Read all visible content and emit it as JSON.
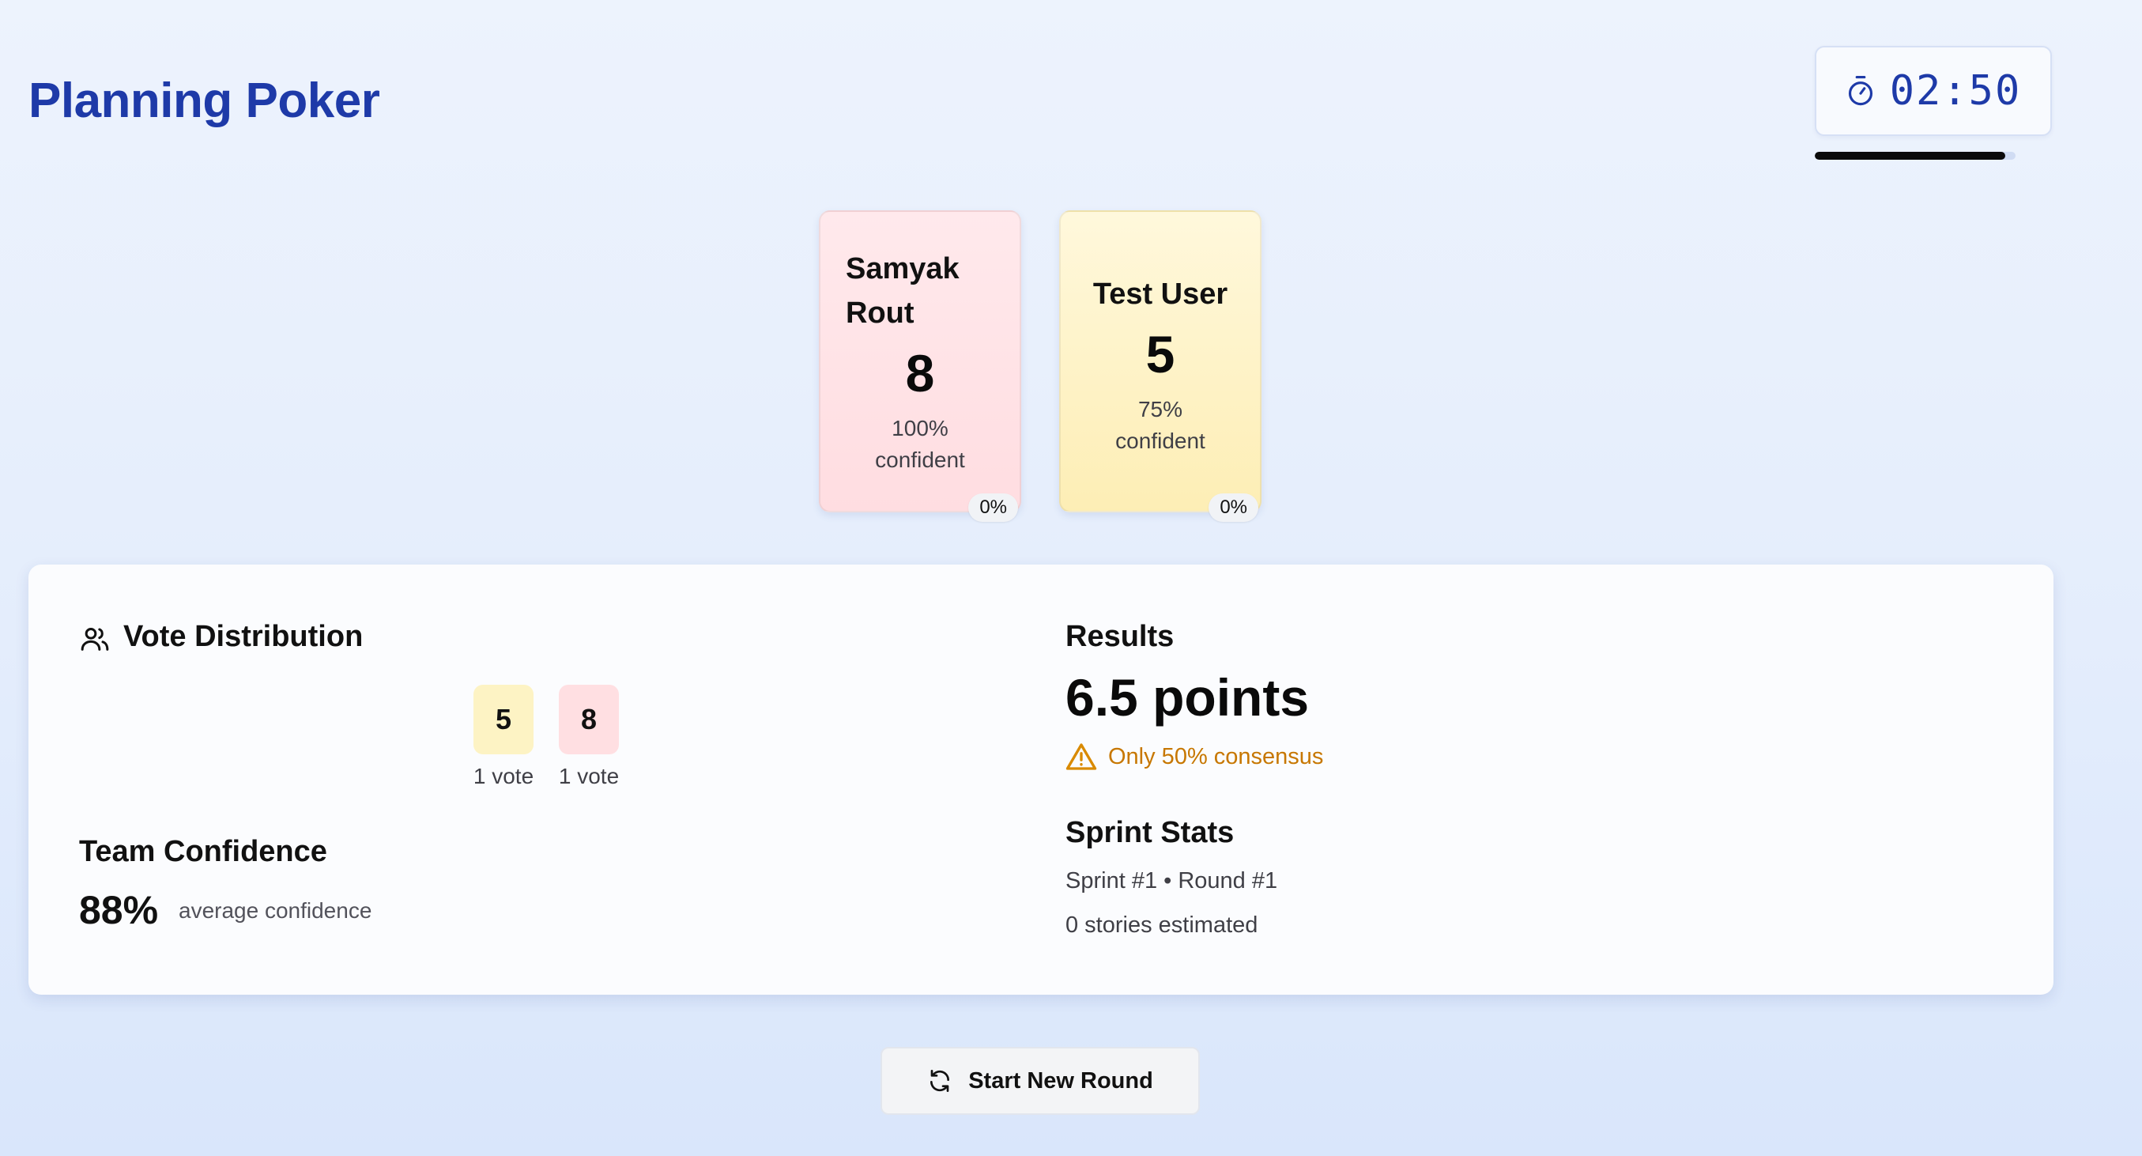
{
  "header": {
    "title": "Planning Poker",
    "timer": {
      "icon": "stopwatch-icon",
      "time": "02:50",
      "progress_fraction": 0.95
    }
  },
  "cards": [
    {
      "name": "Samyak Rout",
      "value": "8",
      "confidence": "100%",
      "confidence_suffix": "confident",
      "badge": "0%",
      "color": "#ffdde1"
    },
    {
      "name": "Test User",
      "value": "5",
      "confidence": "75%",
      "confidence_suffix": "confident",
      "badge": "0%",
      "color": "#fdeeb5"
    }
  ],
  "vote_distribution": {
    "icon": "users-icon",
    "heading": "Vote Distribution",
    "items": [
      {
        "value": "5",
        "count": "1 vote",
        "color": "#fdf3c4"
      },
      {
        "value": "8",
        "count": "1 vote",
        "color": "#ffdfe2"
      }
    ]
  },
  "team_confidence": {
    "heading": "Team Confidence",
    "value": "88%",
    "caption": "average confidence"
  },
  "results": {
    "heading": "Results",
    "points": "6.5 points",
    "warning_icon": "warning-triangle-icon",
    "warning": "Only 50% consensus",
    "warning_color": "#c77700"
  },
  "sprint_stats": {
    "heading": "Sprint Stats",
    "sprint_round": "Sprint #1 • Round #1",
    "stories": "0 stories estimated"
  },
  "actions": {
    "new_round_icon": "refresh-icon",
    "new_round_label": "Start New Round"
  },
  "theme": {
    "accent": "#1e3aa8",
    "background": "#e4edfc"
  }
}
